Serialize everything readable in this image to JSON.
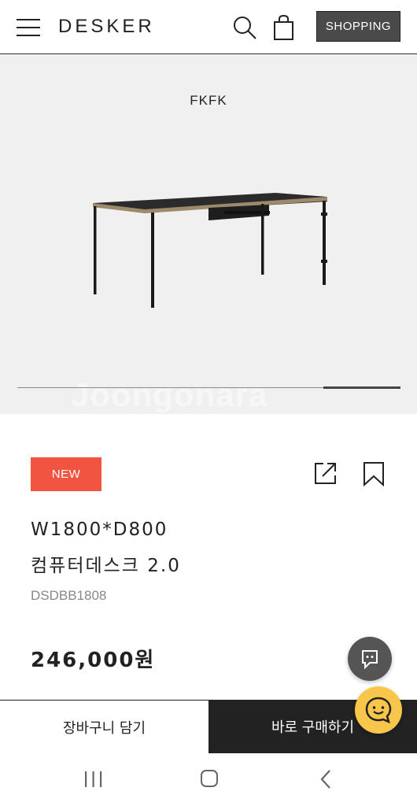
{
  "header": {
    "logo": "DESKER",
    "shopping_label": "SHOPPING",
    "icons": [
      "menu-icon",
      "search-icon",
      "shopping-bag-icon"
    ]
  },
  "hero": {
    "caption": "FKFK",
    "watermark": "Joongonara",
    "slider_position": 1.0
  },
  "product": {
    "badge": "NEW",
    "title_line1": "W1800*D800",
    "title_line2": "컴퓨터데스크 2.0",
    "sku": "DSDBB1808",
    "price": "246,000원",
    "icons": [
      "share-icon",
      "bookmark-icon"
    ]
  },
  "actions": {
    "cart_label": "장바구니 담기",
    "buy_label": "바로 구매하기"
  },
  "colors": {
    "badge": "#f25442",
    "buy_button": "#222222",
    "shopping_button": "#4a4a4a",
    "talk_button": "#f7c64b",
    "chat_button": "#555555"
  }
}
